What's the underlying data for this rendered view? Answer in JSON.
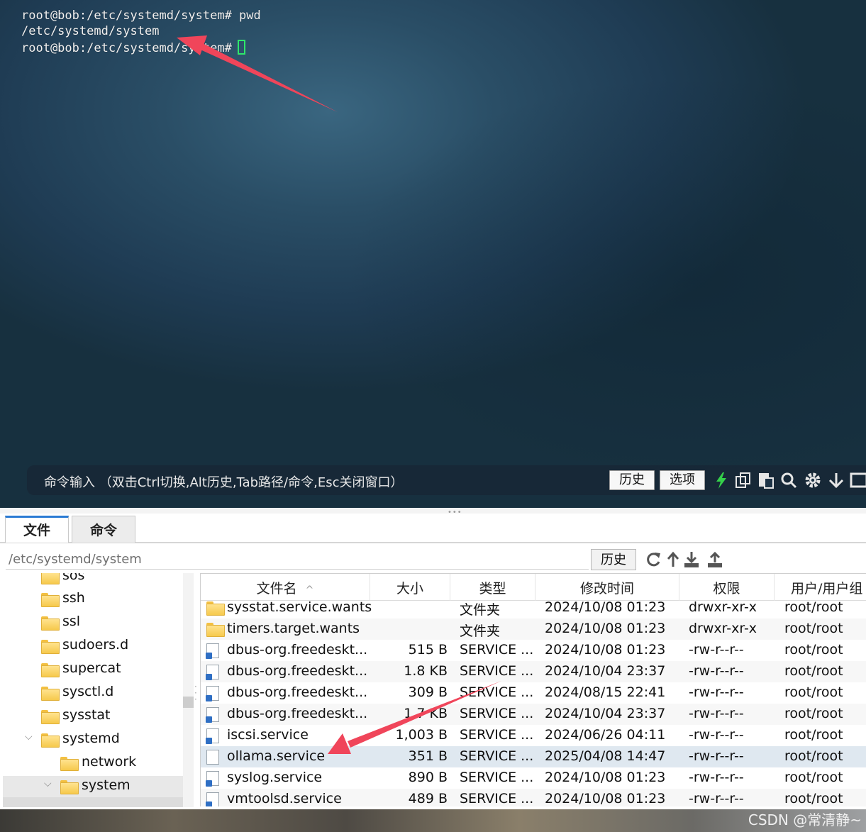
{
  "terminal": {
    "lines": [
      "root@bob:/etc/systemd/system# pwd",
      "/etc/systemd/system",
      "root@bob:/etc/systemd/system#"
    ],
    "command_hint": "命令输入 （双击Ctrl切换,Alt历史,Tab路径/命令,Esc关闭窗口）",
    "history_label": "历史",
    "options_label": "选项",
    "icons": [
      "bolt-icon",
      "copy-icon",
      "paste-icon",
      "search-icon",
      "gear-icon",
      "down-arrow-icon",
      "window-icon"
    ],
    "accent_color": "#2ee86b"
  },
  "tabs": [
    {
      "label": "文件",
      "active": true
    },
    {
      "label": "命令",
      "active": false
    }
  ],
  "path_bar": {
    "path": "/etc/systemd/system",
    "history_label": "历史",
    "icons": [
      "refresh-icon",
      "up-dir-icon",
      "download-icon",
      "upload-icon"
    ]
  },
  "tree": {
    "items": [
      {
        "label": "sos",
        "level": 1,
        "expanded": null,
        "selected": false
      },
      {
        "label": "ssh",
        "level": 1,
        "expanded": null,
        "selected": false
      },
      {
        "label": "ssl",
        "level": 1,
        "expanded": null,
        "selected": false
      },
      {
        "label": "sudoers.d",
        "level": 1,
        "expanded": null,
        "selected": false
      },
      {
        "label": "supercat",
        "level": 1,
        "expanded": null,
        "selected": false
      },
      {
        "label": "sysctl.d",
        "level": 1,
        "expanded": null,
        "selected": false
      },
      {
        "label": "sysstat",
        "level": 1,
        "expanded": null,
        "selected": false
      },
      {
        "label": "systemd",
        "level": 1,
        "expanded": true,
        "selected": false
      },
      {
        "label": "network",
        "level": 2,
        "expanded": null,
        "selected": false
      },
      {
        "label": "system",
        "level": 2,
        "expanded": true,
        "selected": true
      }
    ]
  },
  "file_table": {
    "columns": [
      "文件名",
      "大小",
      "类型",
      "修改时间",
      "权限",
      "用户/用户组"
    ],
    "sort_indicator": "^",
    "rows": [
      {
        "name": "sysstat.service.wants",
        "size": "",
        "type": "文件夹",
        "modified": "2024/10/08 01:23",
        "perm": "drwxr-xr-x",
        "owner": "root/root",
        "icon": "folder",
        "highlight": false
      },
      {
        "name": "timers.target.wants",
        "size": "",
        "type": "文件夹",
        "modified": "2024/10/08 01:23",
        "perm": "drwxr-xr-x",
        "owner": "root/root",
        "icon": "folder",
        "highlight": false
      },
      {
        "name": "dbus-org.freedeskt...",
        "size": "515 B",
        "type": "SERVICE ...",
        "modified": "2024/10/08 01:23",
        "perm": "-rw-r--r--",
        "owner": "root/root",
        "icon": "service",
        "highlight": false
      },
      {
        "name": "dbus-org.freedeskt...",
        "size": "1.8 KB",
        "type": "SERVICE ...",
        "modified": "2024/10/04 23:37",
        "perm": "-rw-r--r--",
        "owner": "root/root",
        "icon": "service",
        "highlight": false
      },
      {
        "name": "dbus-org.freedeskt...",
        "size": "309 B",
        "type": "SERVICE ...",
        "modified": "2024/08/15 22:41",
        "perm": "-rw-r--r--",
        "owner": "root/root",
        "icon": "service",
        "highlight": false
      },
      {
        "name": "dbus-org.freedeskt...",
        "size": "1.7 KB",
        "type": "SERVICE ...",
        "modified": "2024/10/04 23:37",
        "perm": "-rw-r--r--",
        "owner": "root/root",
        "icon": "service",
        "highlight": false
      },
      {
        "name": "iscsi.service",
        "size": "1,003 B",
        "type": "SERVICE ...",
        "modified": "2024/06/26 04:11",
        "perm": "-rw-r--r--",
        "owner": "root/root",
        "icon": "service",
        "highlight": false
      },
      {
        "name": "ollama.service",
        "size": "351 B",
        "type": "SERVICE ...",
        "modified": "2025/04/08 14:47",
        "perm": "-rw-r--r--",
        "owner": "root/root",
        "icon": "file",
        "highlight": true
      },
      {
        "name": "syslog.service",
        "size": "890 B",
        "type": "SERVICE ...",
        "modified": "2024/10/08 01:23",
        "perm": "-rw-r--r--",
        "owner": "root/root",
        "icon": "service",
        "highlight": false
      },
      {
        "name": "vmtoolsd.service",
        "size": "489 B",
        "type": "SERVICE ...",
        "modified": "2024/10/08 01:23",
        "perm": "-rw-r--r--",
        "owner": "root/root",
        "icon": "service",
        "highlight": false
      }
    ],
    "highlight_color": "#dfe8f0"
  },
  "watermark": "CSDN @常清静~",
  "annotation_color": "#f0455a"
}
